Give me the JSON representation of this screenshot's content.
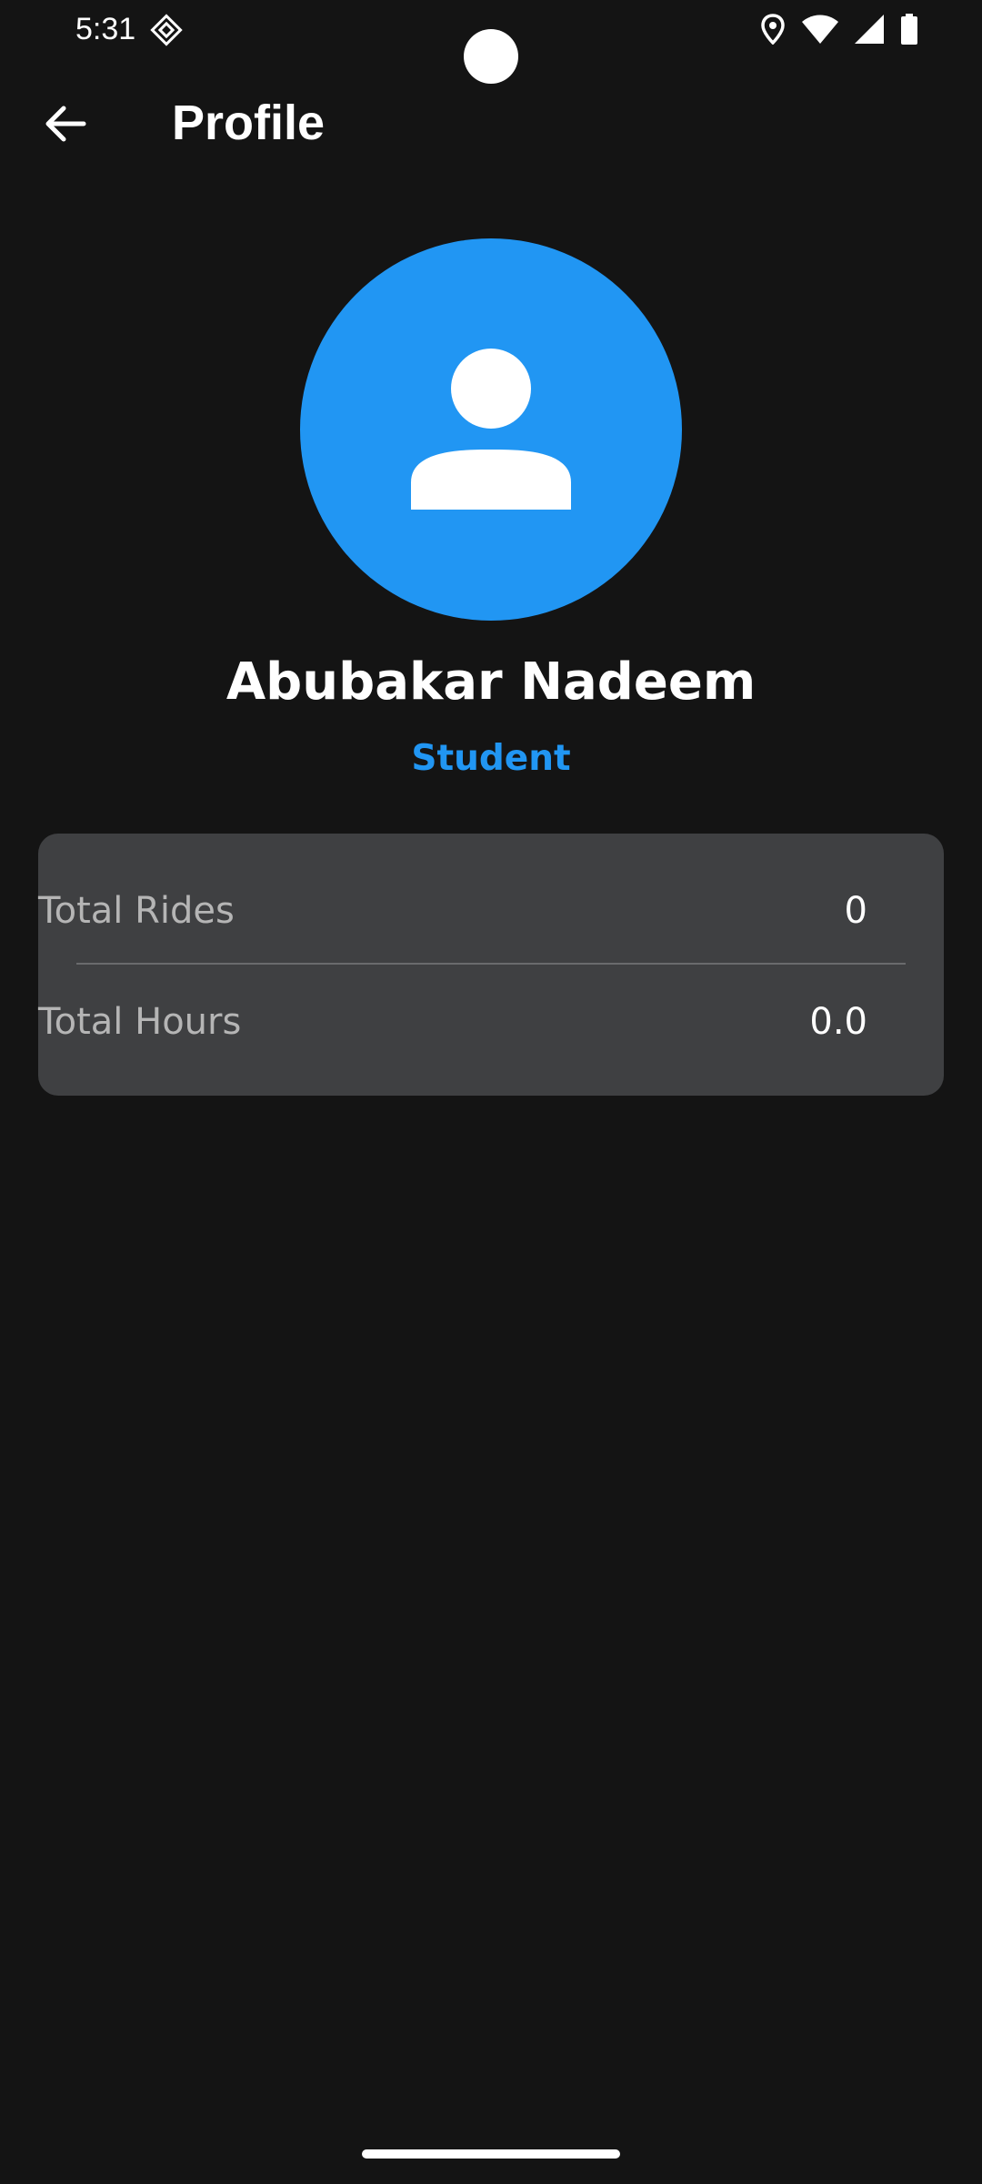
{
  "status_bar": {
    "time": "5:31",
    "left_icons": [
      "app-notification-icon"
    ],
    "right_icons": [
      "location-icon",
      "wifi-icon",
      "cell-signal-icon",
      "battery-icon"
    ]
  },
  "app_bar": {
    "back_icon": "arrow-left-icon",
    "title": "Profile"
  },
  "profile": {
    "avatar_icon": "person-icon",
    "avatar_color": "#2196f3",
    "name": "Abubakar Nadeem",
    "role": "Student",
    "role_color": "#2196f3"
  },
  "stats": [
    {
      "label": "Total Rides",
      "value": "0"
    },
    {
      "label": "Total Hours",
      "value": "0.0"
    }
  ],
  "colors": {
    "background": "#141414",
    "card": "#3f4042",
    "accent": "#2196f3"
  }
}
